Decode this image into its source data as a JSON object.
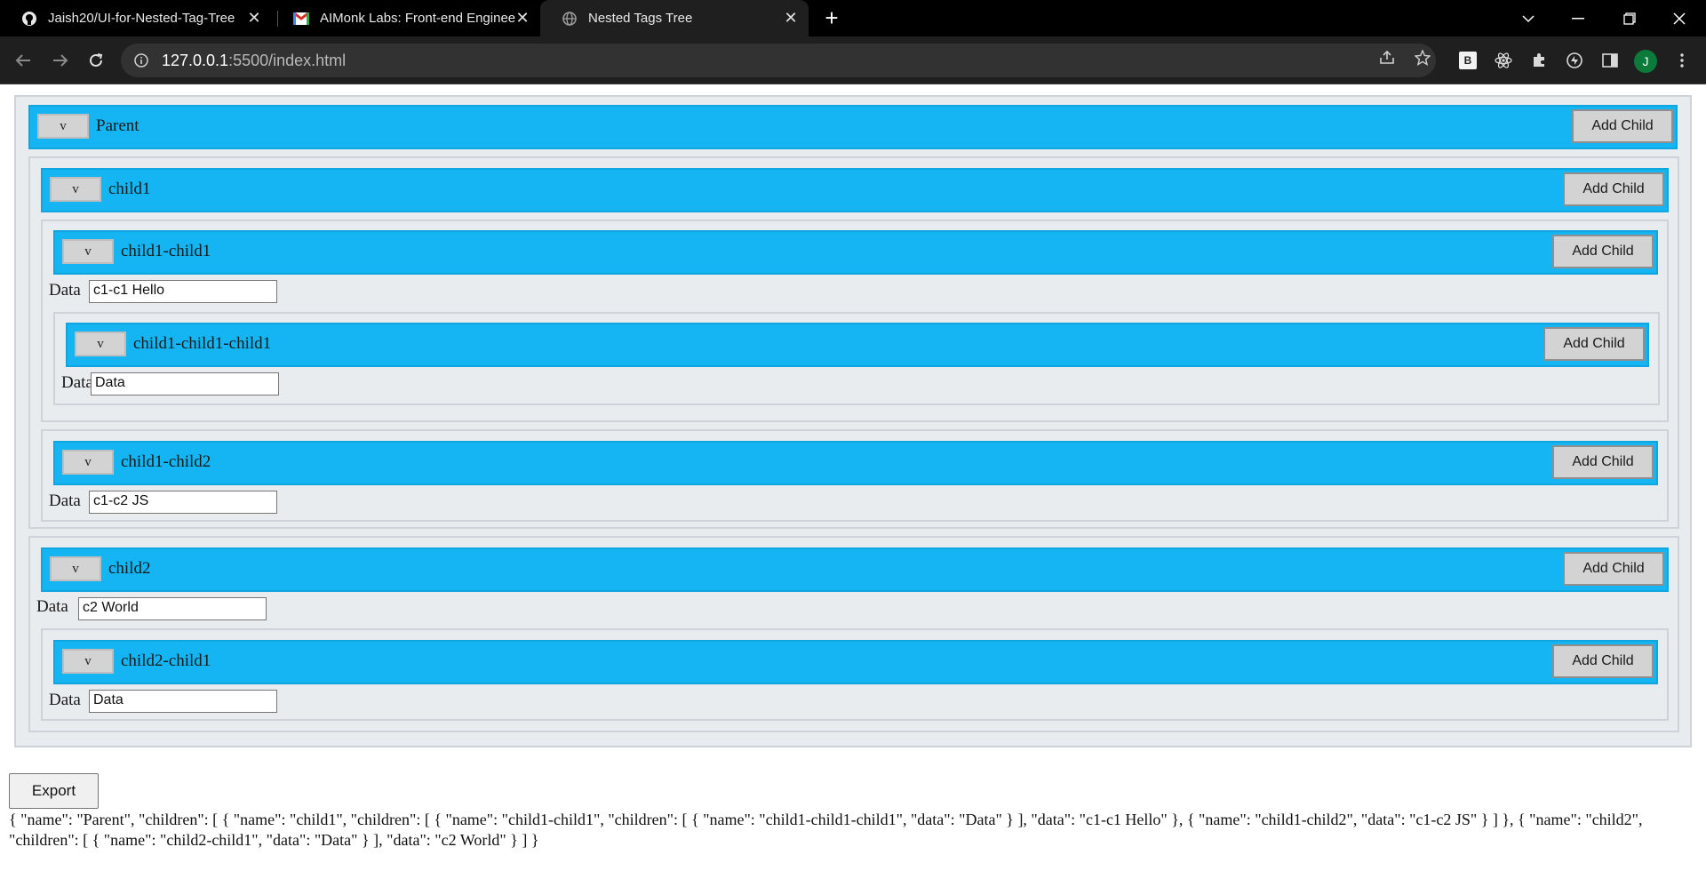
{
  "browser": {
    "tabs": [
      {
        "title": "Jaish20/UI-for-Nested-Tag-Tree",
        "icon": "github-icon",
        "active": false
      },
      {
        "title": "AIMonk Labs: Front-end Enginee",
        "icon": "gmail-icon",
        "active": false
      },
      {
        "title": "Nested Tags Tree",
        "icon": "globe-icon",
        "active": true
      }
    ],
    "url_host": "127.0.0.1",
    "url_path": ":5500/index.html",
    "profile_initial": "J",
    "extension_b_label": "B"
  },
  "tree": {
    "toggle_label": "v",
    "add_child_label": "Add Child",
    "data_label": "Data",
    "nodes": {
      "parent": {
        "name": "Parent"
      },
      "child1": {
        "name": "child1"
      },
      "child1_child1": {
        "name": "child1-child1",
        "data": "c1-c1 Hello"
      },
      "child1_child1_child1": {
        "name": "child1-child1-child1",
        "data": "Data"
      },
      "child1_child2": {
        "name": "child1-child2",
        "data": "c1-c2 JS"
      },
      "child2": {
        "name": "child2",
        "data": "c2 World"
      },
      "child2_child1": {
        "name": "child2-child1",
        "data": "Data"
      }
    }
  },
  "export_label": "Export",
  "export_output": "{ \"name\": \"Parent\", \"children\": [ { \"name\": \"child1\", \"children\": [ { \"name\": \"child1-child1\", \"children\": [ { \"name\": \"child1-child1-child1\", \"data\": \"Data\" } ], \"data\": \"c1-c1 Hello\" }, { \"name\": \"child1-child2\", \"data\": \"c1-c2 JS\" } ] }, { \"name\": \"child2\", \"children\": [ { \"name\": \"child2-child1\", \"data\": \"Data\" } ], \"data\": \"c2 World\" } ] }",
  "colors": {
    "tag_bar": "#14b5f2",
    "box_background": "#e8ecef",
    "chrome_dark": "#1f1f1f"
  }
}
